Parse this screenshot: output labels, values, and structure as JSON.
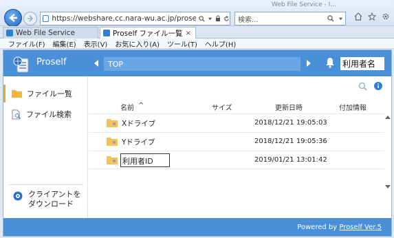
{
  "browser": {
    "window_title": "Web File Service - I...",
    "address": "https://webshare.cc.nara-wu.ac.jp/proself/list/propfind...",
    "search_placeholder": "検索...",
    "tabs": [
      {
        "label": "Web File Service",
        "active": false
      },
      {
        "label": "Proself ファイル一覧",
        "active": true,
        "close": "×"
      }
    ],
    "menu": [
      "ファイル(F)",
      "編集(E)",
      "表示(V)",
      "お気に入り(A)",
      "ツール(T)",
      "ヘルプ(H)"
    ],
    "accent": "#1f66c4"
  },
  "app": {
    "brand": "Proself",
    "path": "TOP",
    "user": "利用者名",
    "header_color": "#4a90d9",
    "sidebar": {
      "items": [
        {
          "label": "ファイル一覧",
          "icon": "folder-icon",
          "active": true
        },
        {
          "label": "ファイル検索",
          "icon": "file-search-icon",
          "active": false
        }
      ],
      "download": {
        "line1": "クライアントを",
        "line2": "ダウンロード"
      }
    },
    "table": {
      "headers": {
        "name": "名前",
        "sort": "^",
        "size": "サイズ",
        "modified": "更新日時",
        "info": "付加情報"
      },
      "rows": [
        {
          "name": "Xドライブ",
          "size": "",
          "modified": "2018/12/21 19:05:03"
        },
        {
          "name": "Yドライブ",
          "size": "",
          "modified": "2018/12/21 19:05:36"
        },
        {
          "name": "利用者ID",
          "size": "",
          "modified": "2019/01/21 13:01:42"
        }
      ]
    },
    "footer": {
      "prefix": "Powered by ",
      "link": "Proself Ver.5"
    }
  }
}
